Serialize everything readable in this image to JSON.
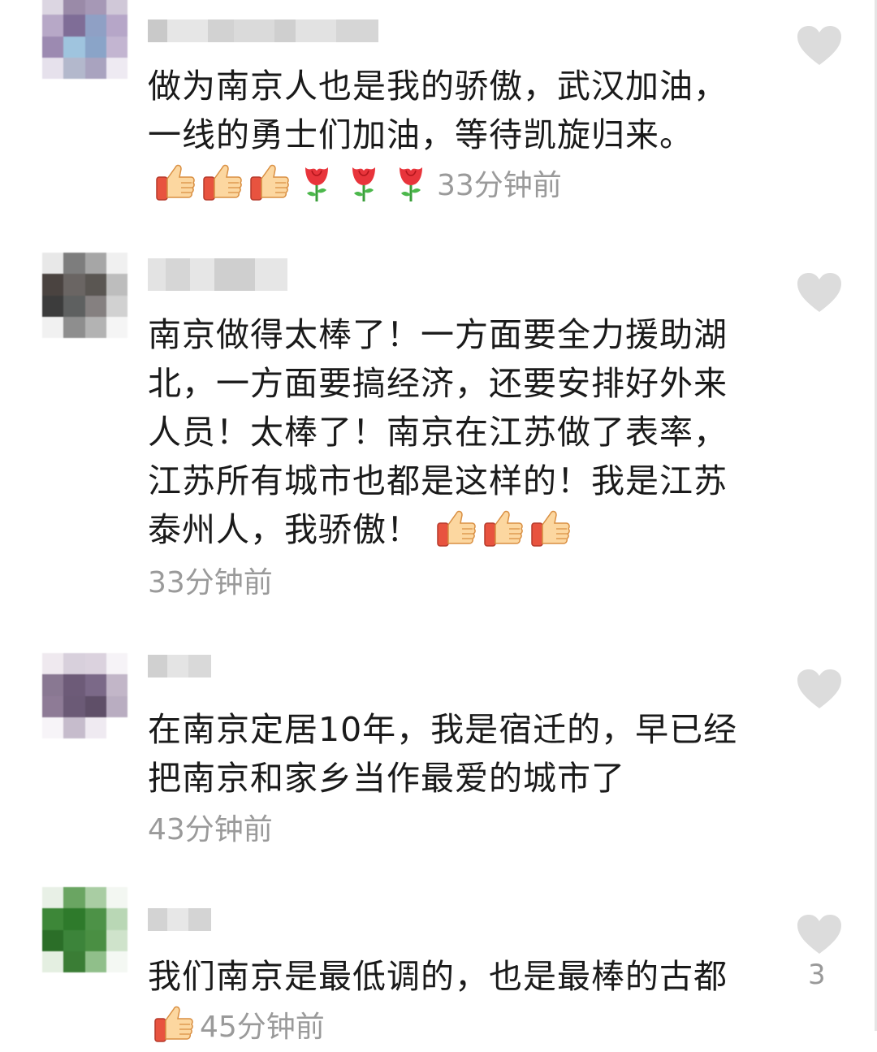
{
  "comments": [
    {
      "text": "做为南京人也是我的骄傲，武汉加油，一线的勇士们加油，等待凯旋归来。",
      "emojis": [
        "thumbs-up",
        "thumbs-up",
        "thumbs-up",
        "rose",
        "rose",
        "rose"
      ],
      "time": "33分钟前",
      "liked": false
    },
    {
      "text": "南京做得太棒了！一方面要全力援助湖北，一方面要搞经济，还要安排好外来人员！太棒了！南京在江苏做了表率，江苏所有城市也都是这样的！我是江苏泰州人，我骄傲！",
      "emojis": [
        "thumbs-up",
        "thumbs-up",
        "thumbs-up"
      ],
      "time": "33分钟前",
      "liked": false
    },
    {
      "text": "在南京定居10年，我是宿迁的，早已经把南京和家乡当作最爱的城市了",
      "emojis": [],
      "time": "43分钟前",
      "liked": false
    },
    {
      "text": "我们南京是最低调的，也是最棒的古都",
      "emojis": [
        "thumbs-up"
      ],
      "time": "45分钟前",
      "liked": false,
      "like_count": "3"
    }
  ],
  "colors": {
    "text": "#1a1a1a",
    "timestamp": "#9a9a9a",
    "heart": "#dcdcdc"
  }
}
